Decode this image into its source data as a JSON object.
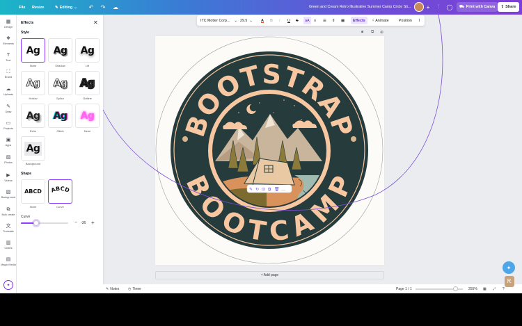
{
  "topbar": {
    "file": "File",
    "resize": "Resize",
    "editing": "Editing",
    "title": "Green and Cream Retro Illustrative Summer Camp Circle Sti...",
    "add": "+",
    "print": "Print with Canva",
    "share": "Share"
  },
  "rail": [
    {
      "label": "Design",
      "icon": "▦"
    },
    {
      "label": "Elements",
      "icon": "❖"
    },
    {
      "label": "Text",
      "icon": "T"
    },
    {
      "label": "Brand",
      "icon": "⛶"
    },
    {
      "label": "Uploads",
      "icon": "☁"
    },
    {
      "label": "Draw",
      "icon": "✎"
    },
    {
      "label": "Projects",
      "icon": "▭"
    },
    {
      "label": "Apps",
      "icon": "▣"
    },
    {
      "label": "Photos",
      "icon": "▨"
    },
    {
      "label": "Videos",
      "icon": "▶"
    },
    {
      "label": "Background",
      "icon": "▧"
    },
    {
      "label": "Bulk create",
      "icon": "⧉"
    },
    {
      "label": "Translate",
      "icon": "文"
    },
    {
      "label": "Charts",
      "icon": "▥"
    },
    {
      "label": "Magic Media",
      "icon": "▤"
    }
  ],
  "panel": {
    "title": "Effects",
    "style_label": "Style",
    "styles": [
      {
        "name": "None",
        "sample": "Ag",
        "cls": "none",
        "selected": true
      },
      {
        "name": "Shadow",
        "sample": "Ag",
        "cls": "shadow"
      },
      {
        "name": "Lift",
        "sample": "Ag",
        "cls": "lift"
      },
      {
        "name": "Hollow",
        "sample": "Ag",
        "cls": "hollow"
      },
      {
        "name": "Splice",
        "sample": "Ag",
        "cls": "splice"
      },
      {
        "name": "Outline",
        "sample": "Ag",
        "cls": "outline"
      },
      {
        "name": "Echo",
        "sample": "Ag",
        "cls": "echo"
      },
      {
        "name": "Glitch",
        "sample": "Ag",
        "cls": "glitch"
      },
      {
        "name": "Neon",
        "sample": "Ag",
        "cls": "neon"
      },
      {
        "name": "Background",
        "sample": "Ag",
        "cls": "background"
      }
    ],
    "shape_label": "Shape",
    "shapes": [
      {
        "name": "None",
        "sample": "ABCD"
      },
      {
        "name": "Curve",
        "sample": "ABCD",
        "selected": true
      }
    ],
    "curve_label": "Curve",
    "curve_value": "-36",
    "curve_fraction": 0.32,
    "minus": "−",
    "plus": "+"
  },
  "toolbar": {
    "font": "ITC Motter Corp...",
    "size": "29.5",
    "effects": "Effects",
    "animate": "Animate",
    "position": "Position"
  },
  "badge": {
    "top_text": "BOOTSTRAP",
    "bottom_text": "BOOTCAMP",
    "colors": {
      "dark": "#263b3c",
      "peach": "#f6c7a1",
      "cream": "#fcfbf8",
      "orange": "#e28a55"
    }
  },
  "canvas": {
    "add_page": "+ Add page"
  },
  "status": {
    "notes": "Notes",
    "timer": "Timer",
    "page": "Page 1 / 1",
    "zoom": "255%"
  }
}
